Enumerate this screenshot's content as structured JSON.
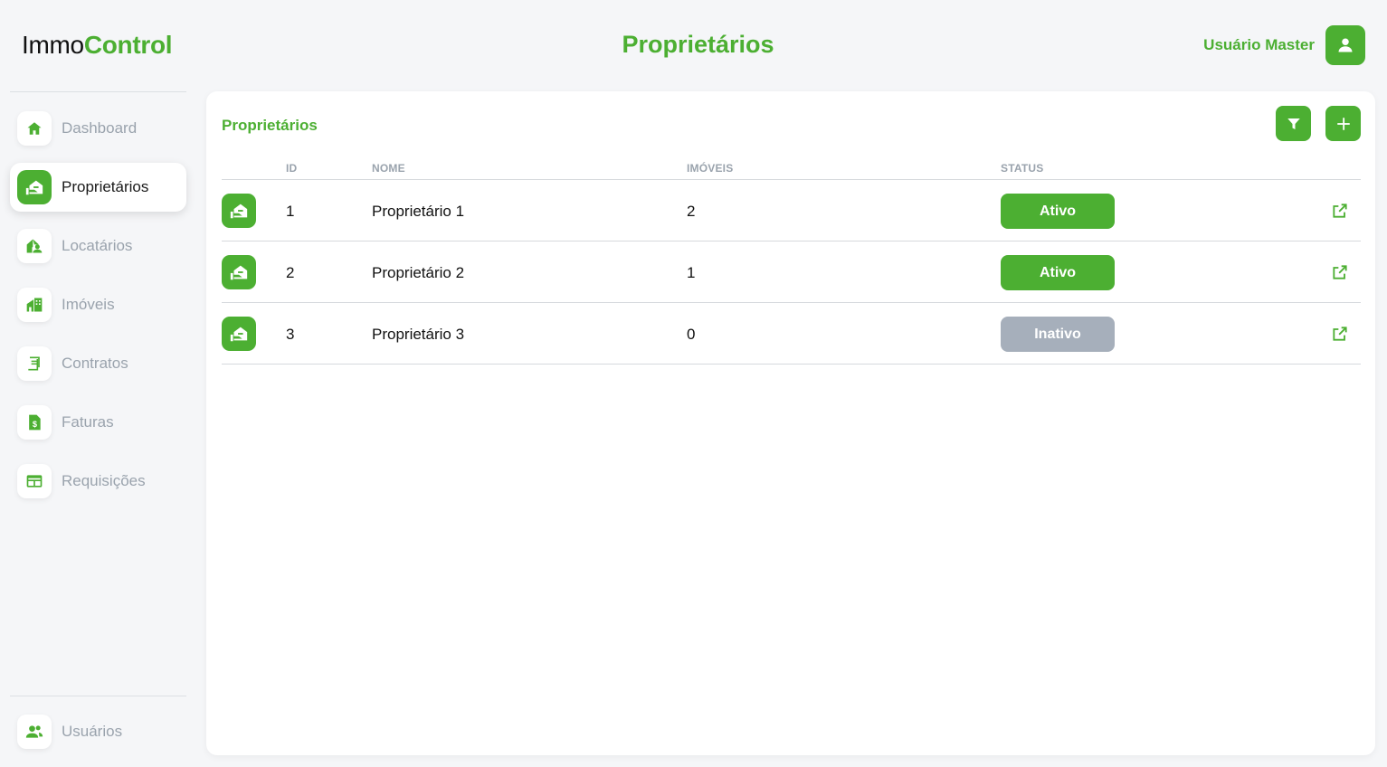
{
  "app": {
    "logo_part1": "Immo",
    "logo_part2": "Control"
  },
  "header": {
    "title": "Proprietários",
    "user_name": "Usuário Master"
  },
  "sidebar": {
    "items": [
      {
        "label": "Dashboard",
        "icon": "home-icon",
        "active": false
      },
      {
        "label": "Proprietários",
        "icon": "owner-icon",
        "active": true
      },
      {
        "label": "Locatários",
        "icon": "tenant-icon",
        "active": false
      },
      {
        "label": "Imóveis",
        "icon": "building-icon",
        "active": false
      },
      {
        "label": "Contratos",
        "icon": "contract-icon",
        "active": false
      },
      {
        "label": "Faturas",
        "icon": "invoice-icon",
        "active": false
      },
      {
        "label": "Requisições",
        "icon": "requests-icon",
        "active": false
      }
    ],
    "bottom_item": {
      "label": "Usuários",
      "icon": "users-icon"
    }
  },
  "main": {
    "card_title": "Proprietários",
    "actions": {
      "filter": "filter-icon",
      "add": "plus-icon"
    },
    "table": {
      "columns": [
        "ID",
        "NOME",
        "IMÓVEIS",
        "STATUS"
      ],
      "rows": [
        {
          "id": "1",
          "nome": "Proprietário 1",
          "imoveis": "2",
          "status": "Ativo"
        },
        {
          "id": "2",
          "nome": "Proprietário 2",
          "imoveis": "1",
          "status": "Ativo"
        },
        {
          "id": "3",
          "nome": "Proprietário 3",
          "imoveis": "0",
          "status": "Inativo"
        }
      ]
    }
  },
  "colors": {
    "accent": "#4caf32",
    "muted": "#9aa3ad",
    "inactive": "#a6afbb"
  }
}
